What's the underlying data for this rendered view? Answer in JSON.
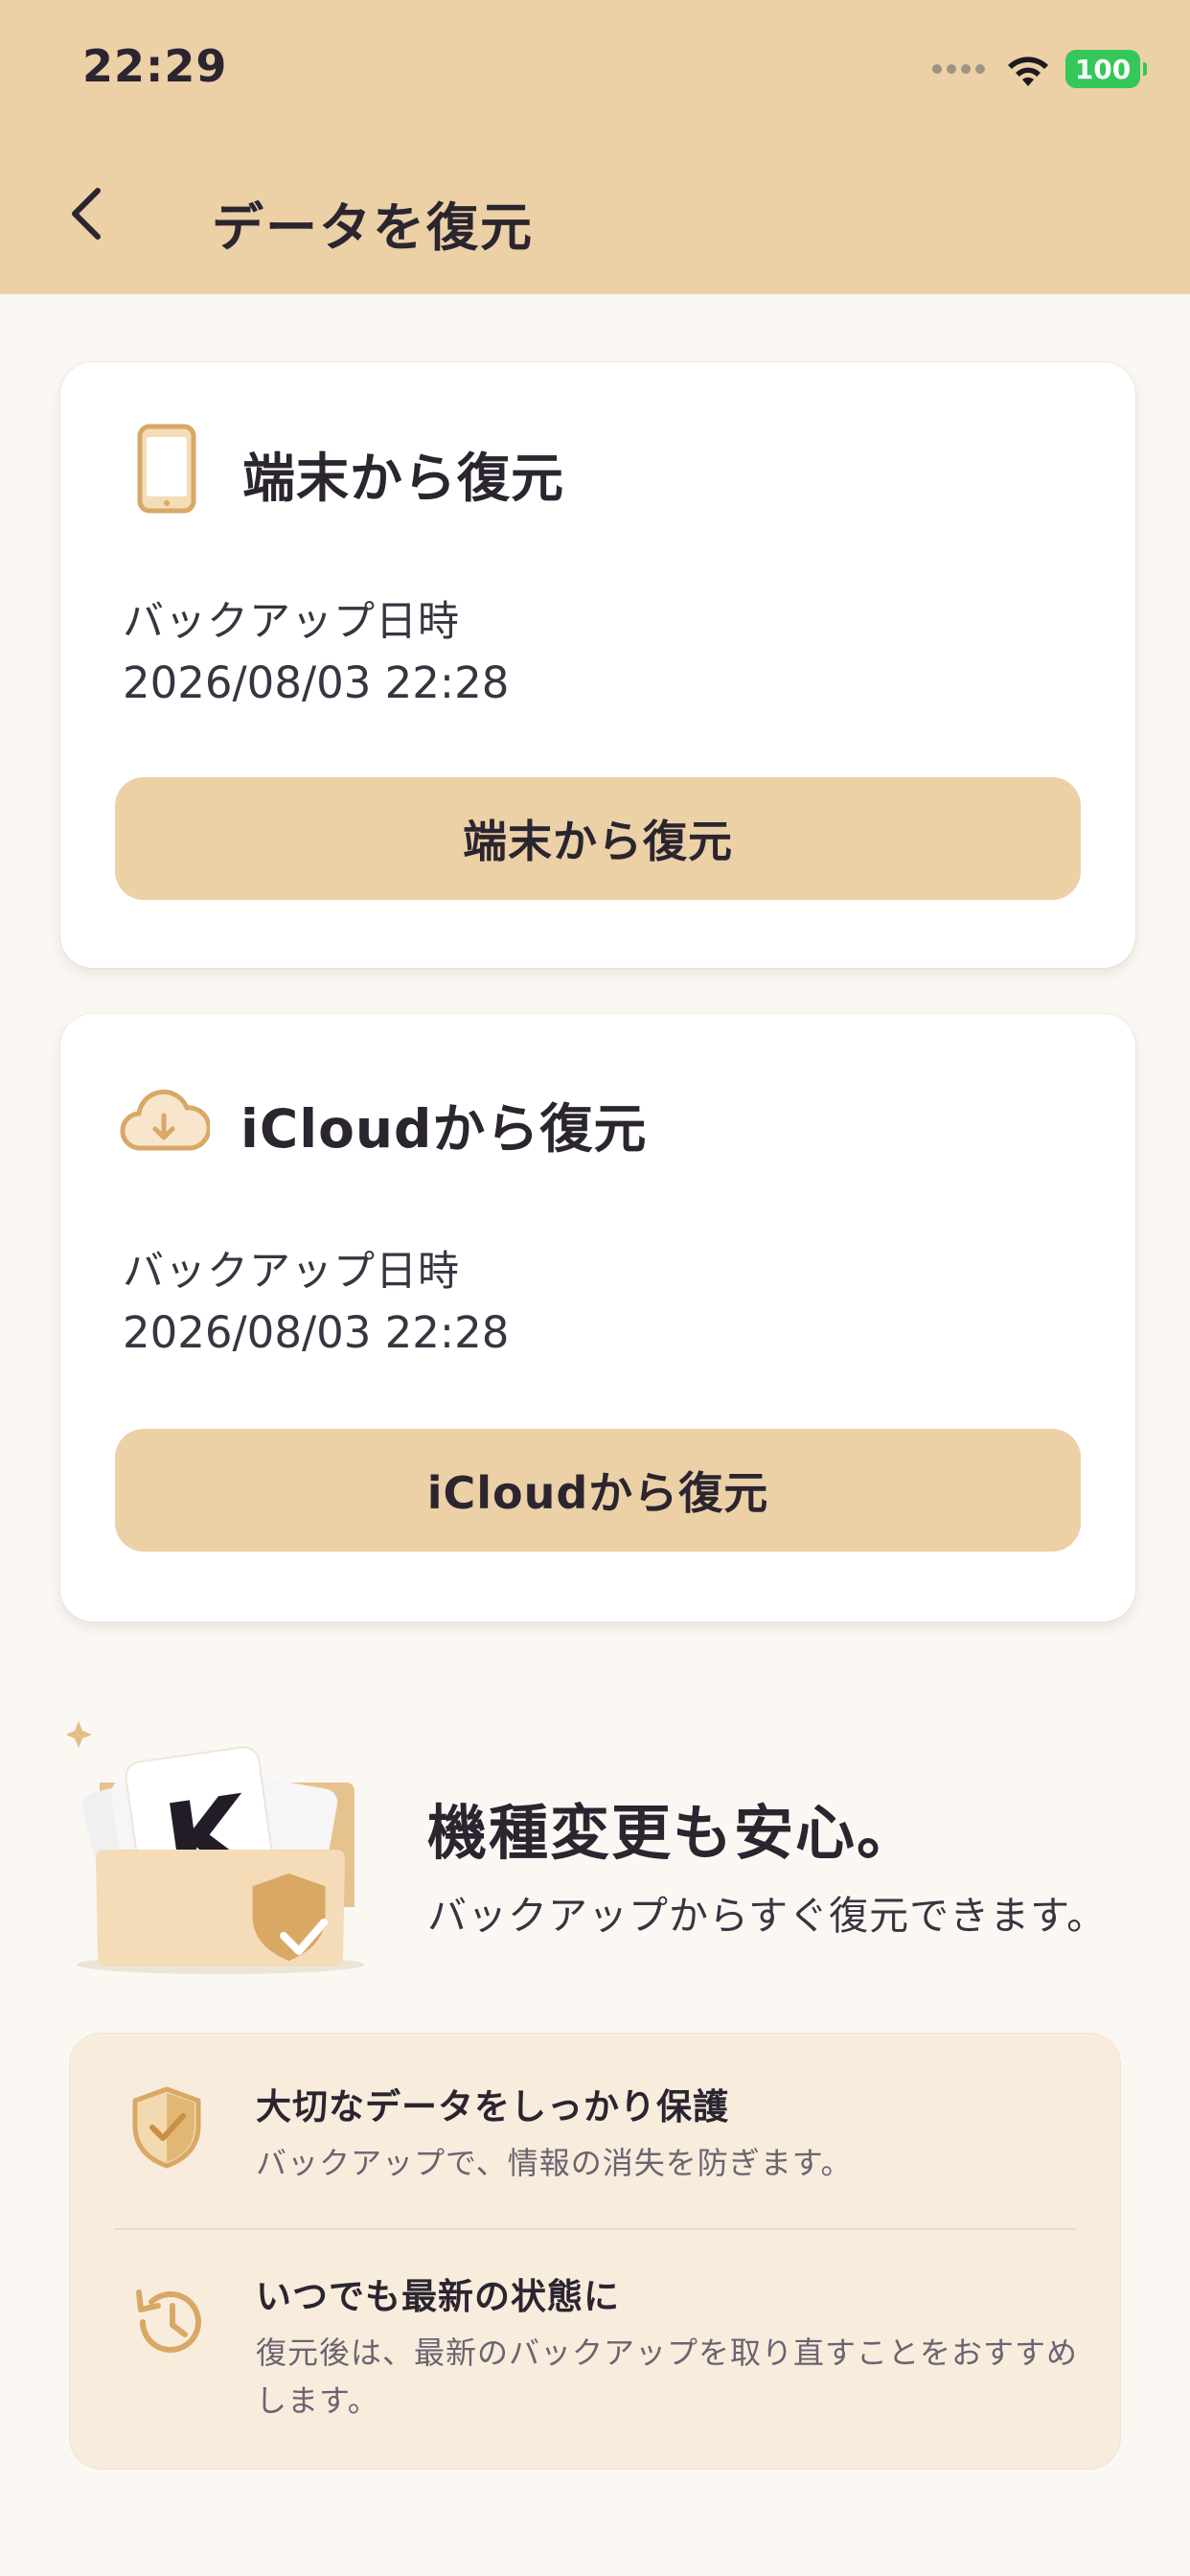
{
  "status_bar": {
    "time": "22:29",
    "battery": "100"
  },
  "header": {
    "title": "データを復元"
  },
  "cards": [
    {
      "title": "端末から復元",
      "backup_label": "バックアップ日時",
      "backup_date": "2026/08/03 22:28",
      "button_label": "端末から復元",
      "icon": "smartphone-icon"
    },
    {
      "title": "iCloudから復元",
      "backup_label": "バックアップ日時",
      "backup_date": "2026/08/03 22:28",
      "button_label": "iCloudから復元",
      "icon": "cloud-download-icon"
    }
  ],
  "promo": {
    "title": "機種変更も安心。",
    "subtitle": "バックアップからすぐ復元できます。",
    "card_letter": "K"
  },
  "info": [
    {
      "title": "大切なデータをしっかり保護",
      "description": "バックアップで、情報の消失を防ぎます。",
      "icon": "shield-check-icon"
    },
    {
      "title": "いつでも最新の状態に",
      "description": "復元後は、最新のバックアップを取り直すことをおすすめします。",
      "icon": "history-icon"
    }
  ],
  "colors": {
    "accent": "#ecd0a6",
    "icon_gold": "#d9a865",
    "background": "#fbf8f4",
    "battery_green": "#34c759"
  }
}
